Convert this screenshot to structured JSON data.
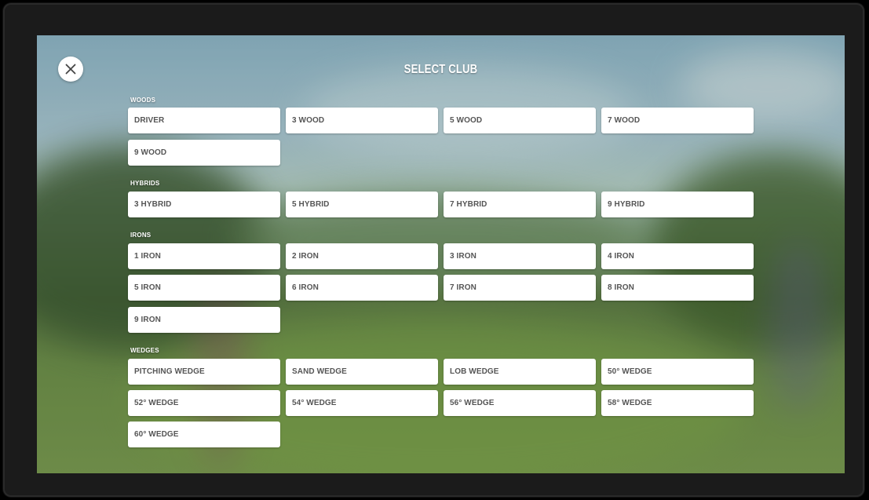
{
  "title": "SELECT CLUB",
  "close_icon": "close-icon",
  "sections": [
    {
      "label": "WOODS",
      "clubs": [
        "DRIVER",
        "3 WOOD",
        "5 WOOD",
        "7 WOOD",
        "9 WOOD"
      ]
    },
    {
      "label": "HYBRIDS",
      "clubs": [
        "3 HYBRID",
        "5 HYBRID",
        "7 HYBRID",
        "9 HYBRID"
      ]
    },
    {
      "label": "IRONS",
      "clubs": [
        "1 IRON",
        "2 IRON",
        "3 IRON",
        "4 IRON",
        "5 IRON",
        "6 IRON",
        "7 IRON",
        "8 IRON",
        "9 IRON"
      ]
    },
    {
      "label": "WEDGES",
      "clubs": [
        "PITCHING WEDGE",
        "SAND WEDGE",
        "LOB WEDGE",
        "50° WEDGE",
        "52° WEDGE",
        "54° WEDGE",
        "56° WEDGE",
        "58° WEDGE",
        "60° WEDGE"
      ]
    }
  ]
}
